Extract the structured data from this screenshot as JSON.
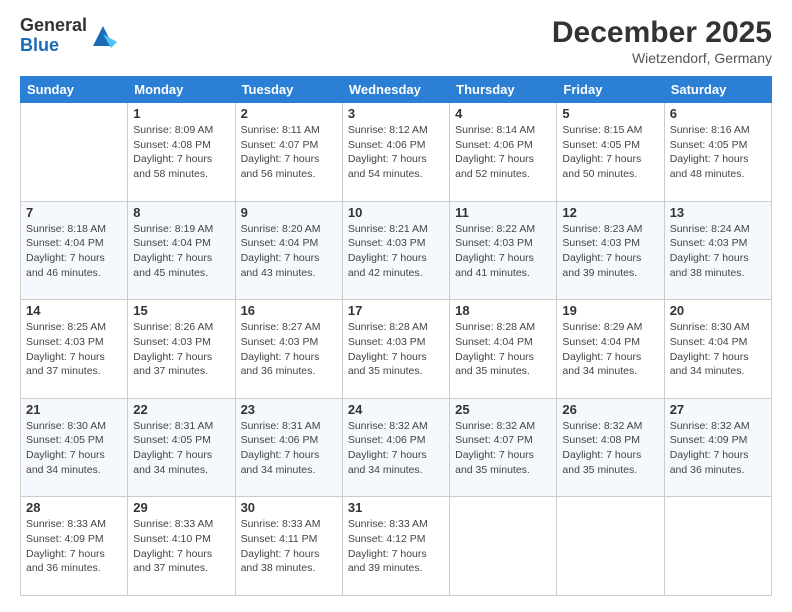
{
  "header": {
    "logo_general": "General",
    "logo_blue": "Blue",
    "month_title": "December 2025",
    "location": "Wietzendorf, Germany"
  },
  "days_of_week": [
    "Sunday",
    "Monday",
    "Tuesday",
    "Wednesday",
    "Thursday",
    "Friday",
    "Saturday"
  ],
  "weeks": [
    [
      {
        "day": "",
        "info": ""
      },
      {
        "day": "1",
        "info": "Sunrise: 8:09 AM\nSunset: 4:08 PM\nDaylight: 7 hours\nand 58 minutes."
      },
      {
        "day": "2",
        "info": "Sunrise: 8:11 AM\nSunset: 4:07 PM\nDaylight: 7 hours\nand 56 minutes."
      },
      {
        "day": "3",
        "info": "Sunrise: 8:12 AM\nSunset: 4:06 PM\nDaylight: 7 hours\nand 54 minutes."
      },
      {
        "day": "4",
        "info": "Sunrise: 8:14 AM\nSunset: 4:06 PM\nDaylight: 7 hours\nand 52 minutes."
      },
      {
        "day": "5",
        "info": "Sunrise: 8:15 AM\nSunset: 4:05 PM\nDaylight: 7 hours\nand 50 minutes."
      },
      {
        "day": "6",
        "info": "Sunrise: 8:16 AM\nSunset: 4:05 PM\nDaylight: 7 hours\nand 48 minutes."
      }
    ],
    [
      {
        "day": "7",
        "info": "Sunrise: 8:18 AM\nSunset: 4:04 PM\nDaylight: 7 hours\nand 46 minutes."
      },
      {
        "day": "8",
        "info": "Sunrise: 8:19 AM\nSunset: 4:04 PM\nDaylight: 7 hours\nand 45 minutes."
      },
      {
        "day": "9",
        "info": "Sunrise: 8:20 AM\nSunset: 4:04 PM\nDaylight: 7 hours\nand 43 minutes."
      },
      {
        "day": "10",
        "info": "Sunrise: 8:21 AM\nSunset: 4:03 PM\nDaylight: 7 hours\nand 42 minutes."
      },
      {
        "day": "11",
        "info": "Sunrise: 8:22 AM\nSunset: 4:03 PM\nDaylight: 7 hours\nand 41 minutes."
      },
      {
        "day": "12",
        "info": "Sunrise: 8:23 AM\nSunset: 4:03 PM\nDaylight: 7 hours\nand 39 minutes."
      },
      {
        "day": "13",
        "info": "Sunrise: 8:24 AM\nSunset: 4:03 PM\nDaylight: 7 hours\nand 38 minutes."
      }
    ],
    [
      {
        "day": "14",
        "info": "Sunrise: 8:25 AM\nSunset: 4:03 PM\nDaylight: 7 hours\nand 37 minutes."
      },
      {
        "day": "15",
        "info": "Sunrise: 8:26 AM\nSunset: 4:03 PM\nDaylight: 7 hours\nand 37 minutes."
      },
      {
        "day": "16",
        "info": "Sunrise: 8:27 AM\nSunset: 4:03 PM\nDaylight: 7 hours\nand 36 minutes."
      },
      {
        "day": "17",
        "info": "Sunrise: 8:28 AM\nSunset: 4:03 PM\nDaylight: 7 hours\nand 35 minutes."
      },
      {
        "day": "18",
        "info": "Sunrise: 8:28 AM\nSunset: 4:04 PM\nDaylight: 7 hours\nand 35 minutes."
      },
      {
        "day": "19",
        "info": "Sunrise: 8:29 AM\nSunset: 4:04 PM\nDaylight: 7 hours\nand 34 minutes."
      },
      {
        "day": "20",
        "info": "Sunrise: 8:30 AM\nSunset: 4:04 PM\nDaylight: 7 hours\nand 34 minutes."
      }
    ],
    [
      {
        "day": "21",
        "info": "Sunrise: 8:30 AM\nSunset: 4:05 PM\nDaylight: 7 hours\nand 34 minutes."
      },
      {
        "day": "22",
        "info": "Sunrise: 8:31 AM\nSunset: 4:05 PM\nDaylight: 7 hours\nand 34 minutes."
      },
      {
        "day": "23",
        "info": "Sunrise: 8:31 AM\nSunset: 4:06 PM\nDaylight: 7 hours\nand 34 minutes."
      },
      {
        "day": "24",
        "info": "Sunrise: 8:32 AM\nSunset: 4:06 PM\nDaylight: 7 hours\nand 34 minutes."
      },
      {
        "day": "25",
        "info": "Sunrise: 8:32 AM\nSunset: 4:07 PM\nDaylight: 7 hours\nand 35 minutes."
      },
      {
        "day": "26",
        "info": "Sunrise: 8:32 AM\nSunset: 4:08 PM\nDaylight: 7 hours\nand 35 minutes."
      },
      {
        "day": "27",
        "info": "Sunrise: 8:32 AM\nSunset: 4:09 PM\nDaylight: 7 hours\nand 36 minutes."
      }
    ],
    [
      {
        "day": "28",
        "info": "Sunrise: 8:33 AM\nSunset: 4:09 PM\nDaylight: 7 hours\nand 36 minutes."
      },
      {
        "day": "29",
        "info": "Sunrise: 8:33 AM\nSunset: 4:10 PM\nDaylight: 7 hours\nand 37 minutes."
      },
      {
        "day": "30",
        "info": "Sunrise: 8:33 AM\nSunset: 4:11 PM\nDaylight: 7 hours\nand 38 minutes."
      },
      {
        "day": "31",
        "info": "Sunrise: 8:33 AM\nSunset: 4:12 PM\nDaylight: 7 hours\nand 39 minutes."
      },
      {
        "day": "",
        "info": ""
      },
      {
        "day": "",
        "info": ""
      },
      {
        "day": "",
        "info": ""
      }
    ]
  ]
}
